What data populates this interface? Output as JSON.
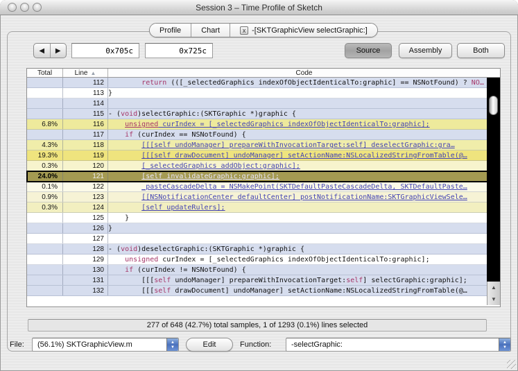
{
  "window": {
    "title": "Session 3 – Time Profile of Sketch"
  },
  "icons": {
    "back": "◀",
    "forward": "▶",
    "sort_asc": "▲",
    "scroll_up": "▲",
    "scroll_down": "▼",
    "popup_arrows": "▲\n▼",
    "tab_close": "x"
  },
  "tabs": {
    "profile": "Profile",
    "chart": "Chart",
    "session_label": "-[SKTGraphicView selectGraphic:]"
  },
  "toolbar": {
    "address_start": "0x705c",
    "address_end": "0x725c",
    "source": "Source",
    "assembly": "Assembly",
    "both": "Both"
  },
  "table": {
    "headers": {
      "total": "Total",
      "line": "Line",
      "code": "Code"
    },
    "rows": [
      {
        "line": "112",
        "total": "",
        "bg": "#d6ddee",
        "segs": [
          {
            "t": "        ",
            "c": "n"
          },
          {
            "t": "return",
            "c": "k"
          },
          {
            "t": " (([_selectedGraphics indexOfObjectIdenticalTo:graphic] == NSNotFound) ? ",
            "c": "n"
          },
          {
            "t": "NO…",
            "c": "k"
          }
        ]
      },
      {
        "line": "113",
        "total": "",
        "bg": "#ffffff",
        "segs": [
          {
            "t": "}",
            "c": "n"
          }
        ]
      },
      {
        "line": "114",
        "total": "",
        "bg": "#d6ddee",
        "segs": []
      },
      {
        "line": "115",
        "total": "",
        "bg": "#d6ddee",
        "segs": [
          {
            "t": "- (",
            "c": "n"
          },
          {
            "t": "void",
            "c": "k"
          },
          {
            "t": ")selectGraphic:(SKTGraphic *)graphic {",
            "c": "n"
          }
        ]
      },
      {
        "line": "116",
        "total": "6.8%",
        "bg": "#eeea9c",
        "segs": [
          {
            "t": "    ",
            "c": "n"
          },
          {
            "t": "unsigned",
            "c": "ku"
          },
          {
            "t": " curIndex = [_selectedGraphics indexOfObjectIdenticalTo:graphic];",
            "c": "l"
          }
        ]
      },
      {
        "line": "117",
        "total": "",
        "bg": "#d6ddee",
        "segs": [
          {
            "t": "    ",
            "c": "n"
          },
          {
            "t": "if",
            "c": "k"
          },
          {
            "t": " (curIndex == NSNotFound) {",
            "c": "n"
          }
        ]
      },
      {
        "line": "118",
        "total": "4.3%",
        "bg": "#f0edaa",
        "segs": [
          {
            "t": "        ",
            "c": "n"
          },
          {
            "t": "[[[self undoManager] prepareWithInvocationTarget:self] deselectGraphic:gra…",
            "c": "l"
          }
        ]
      },
      {
        "line": "119",
        "total": "19.3%",
        "bg": "#efe47e",
        "segs": [
          {
            "t": "        ",
            "c": "n"
          },
          {
            "t": "[[[self drawDocument] undoManager] setActionName:NSLocalizedStringFromTable(@…",
            "c": "l"
          }
        ]
      },
      {
        "line": "120",
        "total": "0.3%",
        "bg": "#f7f4cd",
        "segs": [
          {
            "t": "        ",
            "c": "n"
          },
          {
            "t": "[_selectedGraphics addObject:graphic];",
            "c": "l"
          }
        ]
      },
      {
        "line": "121",
        "total": "24.0%",
        "bg": "#a49a52",
        "sel": true,
        "segs": [
          {
            "t": "        ",
            "c": "n"
          },
          {
            "t": "[self invalidateGraphic:graphic];",
            "c": "l"
          }
        ]
      },
      {
        "line": "122",
        "total": "0.1%",
        "bg": "#fbfae8",
        "segs": [
          {
            "t": "        ",
            "c": "n"
          },
          {
            "t": "_pasteCascadeDelta = NSMakePoint(SKTDefaultPasteCascadeDelta, SKTDefaultPaste…",
            "c": "l"
          }
        ]
      },
      {
        "line": "123",
        "total": "0.9%",
        "bg": "#f6f3d5",
        "segs": [
          {
            "t": "        ",
            "c": "n"
          },
          {
            "t": "[[NSNotificationCenter defaultCenter] postNotificationName:SKTGraphicViewSele…",
            "c": "l"
          }
        ]
      },
      {
        "line": "124",
        "total": "0.3%",
        "bg": "#f2efc0",
        "segs": [
          {
            "t": "        ",
            "c": "n"
          },
          {
            "t": "[self updateRulers];",
            "c": "l"
          }
        ]
      },
      {
        "line": "125",
        "total": "",
        "bg": "#ffffff",
        "segs": [
          {
            "t": "    }",
            "c": "n"
          }
        ]
      },
      {
        "line": "126",
        "total": "",
        "bg": "#d6ddee",
        "segs": [
          {
            "t": "}",
            "c": "n"
          }
        ]
      },
      {
        "line": "127",
        "total": "",
        "bg": "#ffffff",
        "segs": []
      },
      {
        "line": "128",
        "total": "",
        "bg": "#d6ddee",
        "segs": [
          {
            "t": "- (",
            "c": "n"
          },
          {
            "t": "void",
            "c": "k"
          },
          {
            "t": ")deselectGraphic:(SKTGraphic *)graphic {",
            "c": "n"
          }
        ]
      },
      {
        "line": "129",
        "total": "",
        "bg": "#ffffff",
        "segs": [
          {
            "t": "    ",
            "c": "n"
          },
          {
            "t": "unsigned",
            "c": "k"
          },
          {
            "t": " curIndex = [_selectedGraphics indexOfObjectIdenticalTo:graphic];",
            "c": "n"
          }
        ]
      },
      {
        "line": "130",
        "total": "",
        "bg": "#d6ddee",
        "segs": [
          {
            "t": "    ",
            "c": "n"
          },
          {
            "t": "if",
            "c": "k"
          },
          {
            "t": " (curIndex != NSNotFound) {",
            "c": "n"
          }
        ]
      },
      {
        "line": "131",
        "total": "",
        "bg": "#d6ddee",
        "segs": [
          {
            "t": "        [[[",
            "c": "n"
          },
          {
            "t": "self",
            "c": "k"
          },
          {
            "t": " undoManager] prepareWithInvocationTarget:",
            "c": "n"
          },
          {
            "t": "self",
            "c": "k"
          },
          {
            "t": "] selectGraphic:graphic];",
            "c": "n"
          }
        ]
      },
      {
        "line": "132",
        "total": "",
        "bg": "#d6ddee",
        "segs": [
          {
            "t": "        [[[",
            "c": "n"
          },
          {
            "t": "self",
            "c": "k"
          },
          {
            "t": " drawDocument] undoManager] setActionName:NSLocalizedStringFromTable(@…",
            "c": "n"
          }
        ]
      }
    ]
  },
  "status": {
    "text": "277 of 648 (42.7%) total samples, 1 of 1293 (0.1%) lines selected"
  },
  "footer": {
    "file_label": "File:",
    "file_value": "(56.1%) SKTGraphicView.m",
    "edit_label": "Edit",
    "function_label": "Function:",
    "function_value": "-selectGraphic:"
  },
  "colors": {
    "row_blue": "#d6ddee",
    "row_white": "#ffffff",
    "heat_strong": "#efe47e",
    "heat_medium": "#eeea9c",
    "selected_row": "#a49a52",
    "link": "#4343b4",
    "keyword": "#a53568",
    "popup_button_blue": "#4a71bd"
  }
}
